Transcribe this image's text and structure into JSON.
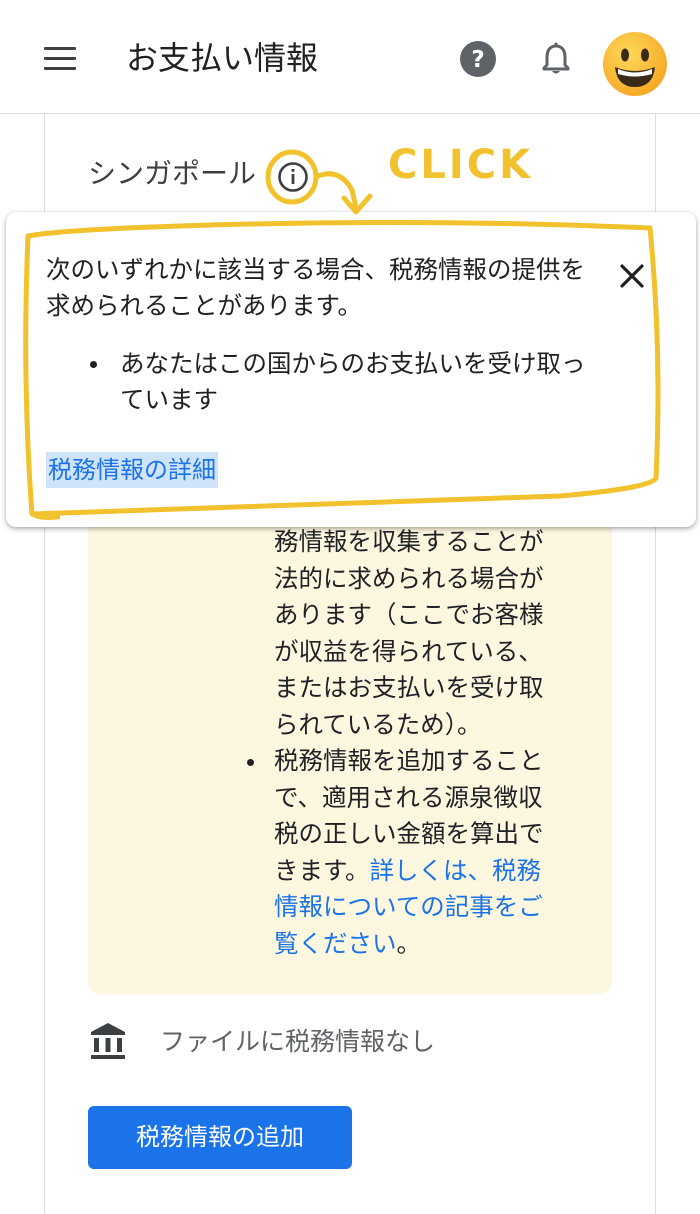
{
  "app_bar": {
    "title": "お支払い情報",
    "menu_icon": "menu-icon",
    "help_icon": "help-icon",
    "bell_icon": "notifications-icon",
    "avatar_icon": "smiley-face-avatar"
  },
  "card": {
    "country_label": "シンガポール",
    "info_icon": "info-icon",
    "notice": {
      "items": [
        "務情報を収集することが法的に求められる場合があります（ここでお客様が収益を得られている、またはお支払いを受け取られているため）。",
        "税務情報を追加することで、適用される源泉徴収税の正しい金額を算出できます。"
      ],
      "link_text": "詳しくは、税務情報についての記事をご覧ください",
      "link_suffix": "。"
    },
    "file_status": "ファイルに税務情報なし",
    "bank_icon": "bank-icon",
    "add_button": "税務情報の追加"
  },
  "annotation": {
    "text": "CLICK",
    "color": "#f2c12e"
  },
  "tooltip": {
    "intro": "次のいずれかに該当する場合、税務情報の提供を求められることがあります。",
    "bullets": [
      "あなたはこの国からのお支払いを受け取っています"
    ],
    "link": "税務情報の詳細",
    "close_icon": "close-icon"
  },
  "colors": {
    "accent": "#1a73e8",
    "notice_bg": "#fef7e0",
    "text": "#202124"
  }
}
